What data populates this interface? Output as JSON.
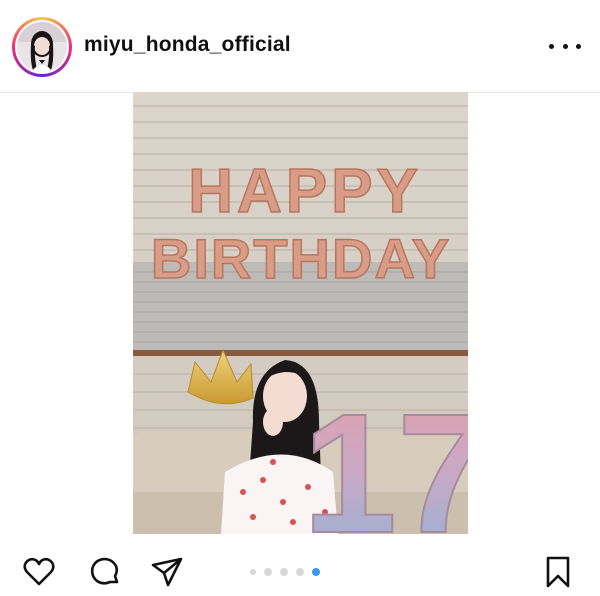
{
  "post": {
    "username": "miyu_honda_official",
    "carousel": {
      "total": 5,
      "active_index": 4
    }
  },
  "photo": {
    "balloon_text_row1": "HAPPY",
    "balloon_text_row2": "BIRTHDAY",
    "number_balloons": "17"
  },
  "icons": {
    "more": "more-options-icon",
    "like": "heart-icon",
    "comment": "comment-icon",
    "share": "send-icon",
    "save": "bookmark-icon"
  },
  "colors": {
    "carousel_active": "#3897f0",
    "carousel_inactive": "#d7d7d7",
    "balloon_rose_gold": "#d99c86"
  }
}
